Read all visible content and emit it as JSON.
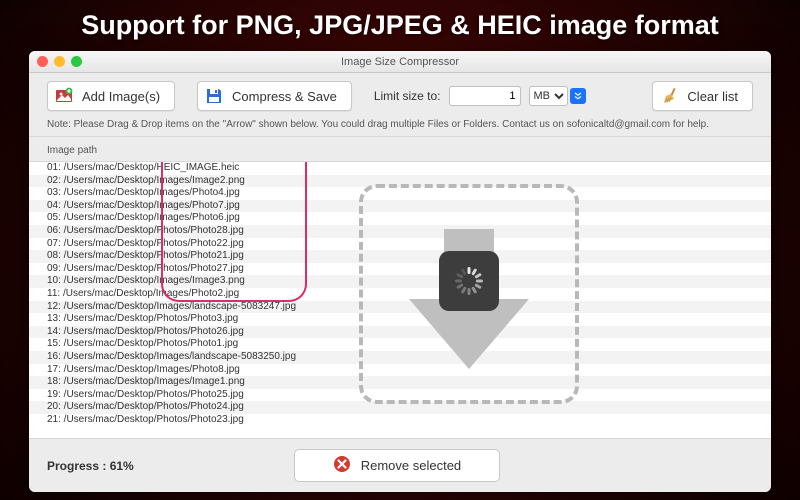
{
  "hero": "Support for PNG, JPG/JPEG & HEIC image format",
  "window": {
    "title": "Image Size Compressor"
  },
  "toolbar": {
    "add_label": "Add Image(s)",
    "compress_label": "Compress & Save",
    "limit_label": "Limit size to:",
    "limit_value": "1",
    "limit_unit": "MB",
    "clear_label": "Clear list"
  },
  "note": "Note: Please Drag & Drop items on the \"Arrow\" shown below. You could drag multiple Files or Folders. Contact us on sofonicaltd@gmail.com for help.",
  "table": {
    "header": "Image path"
  },
  "rows": [
    "01: /Users/mac/Desktop/HEIC_IMAGE.heic",
    "02: /Users/mac/Desktop/Images/Image2.png",
    "03: /Users/mac/Desktop/Images/Photo4.jpg",
    "04: /Users/mac/Desktop/Images/Photo7.jpg",
    "05: /Users/mac/Desktop/Images/Photo6.jpg",
    "06: /Users/mac/Desktop/Photos/Photo28.jpg",
    "07: /Users/mac/Desktop/Photos/Photo22.jpg",
    "08: /Users/mac/Desktop/Photos/Photo21.jpg",
    "09: /Users/mac/Desktop/Photos/Photo27.jpg",
    "10: /Users/mac/Desktop/Images/Image3.png",
    "11: /Users/mac/Desktop/Images/Photo2.jpg",
    "12: /Users/mac/Desktop/Images/landscape-5083247.jpg",
    "13: /Users/mac/Desktop/Photos/Photo3.jpg",
    "14: /Users/mac/Desktop/Photos/Photo26.jpg",
    "15: /Users/mac/Desktop/Photos/Photo1.jpg",
    "16: /Users/mac/Desktop/Images/landscape-5083250.jpg",
    "17: /Users/mac/Desktop/Images/Photo8.jpg",
    "18: /Users/mac/Desktop/Images/Image1.png",
    "19: /Users/mac/Desktop/Photos/Photo25.jpg",
    "20: /Users/mac/Desktop/Photos/Photo24.jpg",
    "21: /Users/mac/Desktop/Photos/Photo23.jpg"
  ],
  "footer": {
    "progress": "Progress : 61%",
    "remove_label": "Remove selected"
  }
}
